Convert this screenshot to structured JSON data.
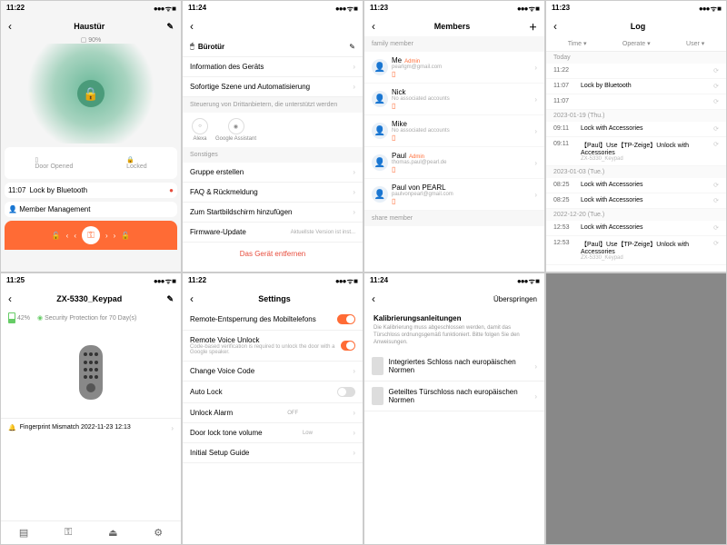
{
  "s1": {
    "time": "11:22",
    "title": "Haustür",
    "battery": "90%",
    "card": {
      "opened": "Door Opened",
      "locked": "Locked"
    },
    "log1": {
      "t": "11:07",
      "e": "Lock by Bluetooth"
    },
    "mgmt": "Member Management"
  },
  "s2": {
    "time": "11:24",
    "title": "Bürotür",
    "info": "Information des Geräts",
    "scene": "Sofortige Szene und Automatisierung",
    "third": "Steuerung von Drittanbietern, die unterstützt werden",
    "alexa": "Alexa",
    "google": "Google Assistant",
    "other": "Sonstiges",
    "group": "Gruppe erstellen",
    "faq": "FAQ & Rückmeldung",
    "home": "Zum Startbildschirm hinzufügen",
    "fw": "Firmware-Update",
    "fwv": "Aktuellste Version ist inst...",
    "remove": "Das Gerät entfernen"
  },
  "s3": {
    "time": "11:23",
    "title": "Members",
    "sec1": "family member",
    "sec2": "share member",
    "members": [
      {
        "name": "Me",
        "admin": true,
        "email": "pearlgm@gmail.com"
      },
      {
        "name": "Nick",
        "admin": false,
        "email": "No associated accounts"
      },
      {
        "name": "Mike",
        "admin": false,
        "email": "No associated accounts"
      },
      {
        "name": "Paul",
        "admin": true,
        "email": "thomas.paul@pearl.de"
      },
      {
        "name": "Paul von PEARL",
        "admin": false,
        "email": "paulvonpearl@gmail.com"
      }
    ]
  },
  "s4": {
    "time": "11:23",
    "title": "Log",
    "filters": [
      "Time ▾",
      "Operate ▾",
      "User ▾"
    ],
    "days": [
      {
        "label": "Today",
        "rows": [
          {
            "t": "11:22",
            "e": ""
          },
          {
            "t": "11:07",
            "e": "Lock by Bluetooth"
          },
          {
            "t": "11:07",
            "e": ""
          }
        ]
      },
      {
        "label": "2023-01-19 (Thu.)",
        "rows": [
          {
            "t": "09:11",
            "e": "Lock with Accessories"
          },
          {
            "t": "09:11",
            "e": "【Paul】Use【TP-Zeige】Unlock with Accessories",
            "sub": "ZX-5330_Keypad"
          }
        ]
      },
      {
        "label": "2023-01-03 (Tue.)",
        "rows": [
          {
            "t": "08:25",
            "e": "Lock with Accessories"
          },
          {
            "t": "08:25",
            "e": "Lock with Accessories"
          }
        ]
      },
      {
        "label": "2022-12-20 (Tue.)",
        "rows": [
          {
            "t": "12:53",
            "e": "Lock with Accessories"
          },
          {
            "t": "12:53",
            "e": "【Paul】Use【TP-Zeige】Unlock with Accessories",
            "sub": "ZX-5330_Keypad"
          }
        ]
      }
    ]
  },
  "s5": {
    "time": "11:25",
    "title": "ZX-5330_Keypad",
    "batt": "42%",
    "sec": "Security Protection for 70 Day(s)",
    "event": "Fingerprint Mismatch 2022-11-23 12:13"
  },
  "s6": {
    "time": "11:22",
    "title": "Settings",
    "rows": [
      {
        "l": "Remote-Entsperrung des Mobiltelefons",
        "t": "on"
      },
      {
        "l": "Remote Voice Unlock",
        "sub": "Code-based verification is required to unlock the door with a Google speaker.",
        "t": "on"
      },
      {
        "l": "Change Voice Code",
        "t": "chev"
      },
      {
        "l": "Auto Lock",
        "t": "off"
      },
      {
        "l": "Unlock Alarm",
        "v": "OFF",
        "t": "chev"
      },
      {
        "l": "Door lock tone volume",
        "v": "Low",
        "t": "chev"
      },
      {
        "l": "Initial Setup Guide",
        "t": "chev"
      }
    ]
  },
  "s7": {
    "time": "11:24",
    "skip": "Überspringen",
    "heading": "Kalibrierungsanleitungen",
    "desc": "Die Kalibrierung muss abgeschlossen werden, damit das Türschloss ordnungsgemäß funktioniert. Bitte folgen Sie den Anweisungen.",
    "opt1": "Integriertes Schloss nach europäischen Normen",
    "opt2": "Geteiltes Türschloss nach europäischen Normen"
  }
}
